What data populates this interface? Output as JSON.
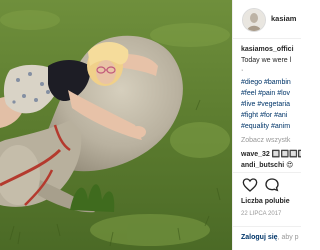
{
  "post": {
    "header_username": "kasiam",
    "caption_username": "kasiamos_offici",
    "caption_text": "Today we were l",
    "caption_dot": "·",
    "hashtag_lines": [
      "#diego #bambin",
      "#feel #pain #lov",
      "#live #vegetaria",
      "#fight #for #ani",
      "#equality #anim"
    ],
    "see_all_comments": "Zobacz wszystk"
  },
  "comments": [
    {
      "username": "wave_32",
      "text": "🔲🔲🔲🔲"
    },
    {
      "username": "andi_butschi",
      "text": "😍"
    }
  ],
  "icons": {
    "like": "heart-icon",
    "comment": "comment-bubble-icon"
  },
  "likes_label": "Liczba polubie",
  "date": "22 LIPCA 2017",
  "login": {
    "link": "Zaloguj się",
    "text": ", aby p"
  },
  "colors": {
    "hashtag": "#003569",
    "muted": "#999999",
    "text": "#262626"
  }
}
